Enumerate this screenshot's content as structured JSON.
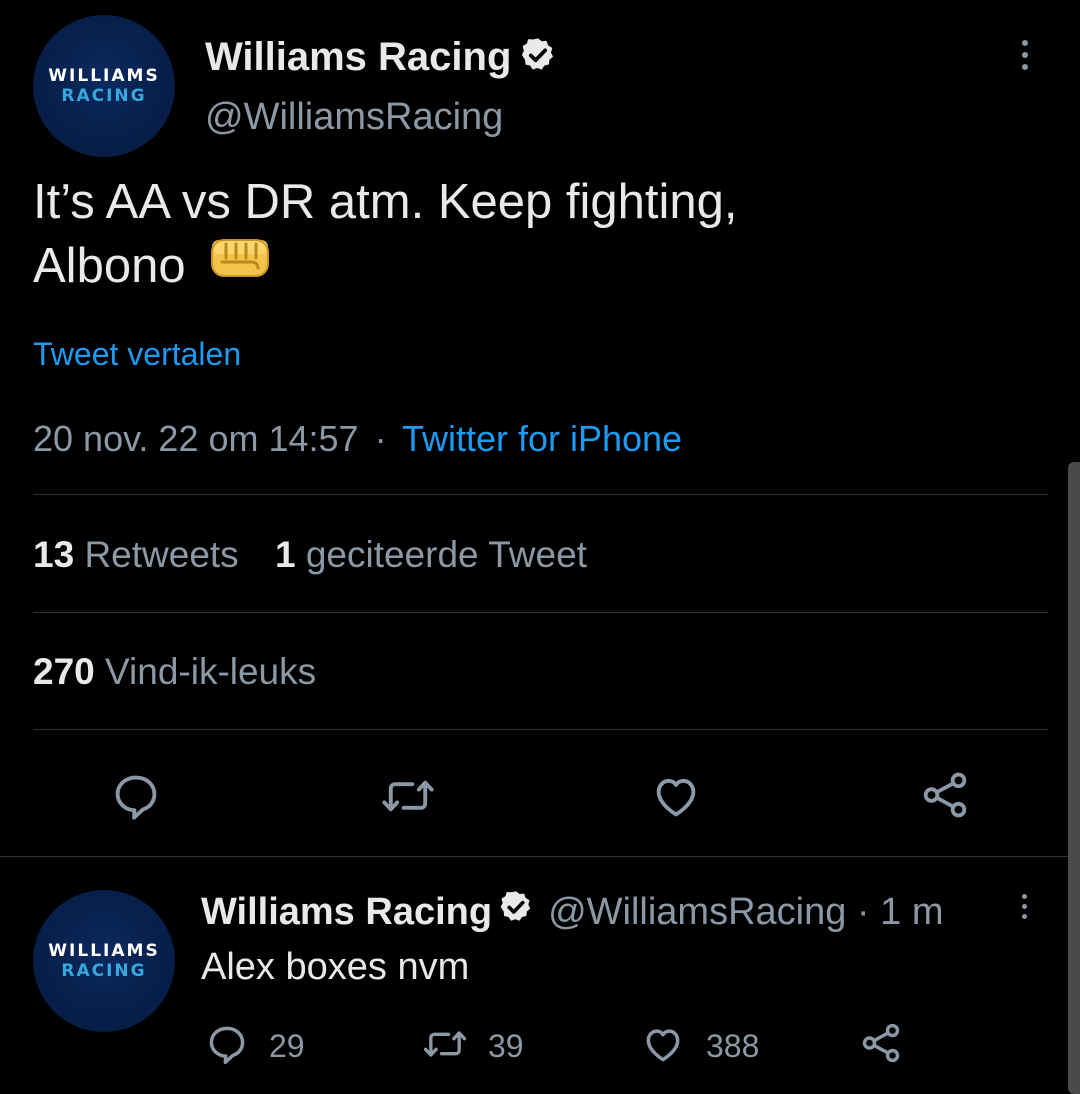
{
  "main_tweet": {
    "avatar": {
      "line1": "WILLIAMS",
      "line2": "RACING"
    },
    "display_name": "Williams Racing",
    "verified_icon": "verified-badge-icon",
    "handle": "@WilliamsRacing",
    "text_line1": "It’s AA vs DR atm. Keep fighting,",
    "text_line2": "Albono",
    "emoji": "👊",
    "translate_link": "Tweet vertalen",
    "timestamp": "20 nov. 22 om 14:57",
    "separator": "·",
    "source": "Twitter for iPhone",
    "retweets_count": "13",
    "retweets_label": "Retweets",
    "quotes_count": "1",
    "quotes_label": "geciteerde Tweet",
    "likes_count": "270",
    "likes_label": "Vind-ik-leuks",
    "actions": [
      "reply-icon",
      "retweet-icon",
      "like-icon",
      "share-icon"
    ]
  },
  "reply_tweet": {
    "avatar": {
      "line1": "WILLIAMS",
      "line2": "RACING"
    },
    "display_name": "Williams Racing",
    "handle_time": "@WilliamsRacing · 1 m",
    "text": "Alex boxes nvm",
    "reply_count": "29",
    "retweet_count": "39",
    "like_count": "388"
  },
  "colors": {
    "background": "#000000",
    "text": "#e7e9ea",
    "muted": "#8b98a5",
    "link": "#1d9bf0",
    "divider": "#2f3336",
    "avatar_bg": "#071f4a",
    "avatar_accent": "#37a7df"
  }
}
